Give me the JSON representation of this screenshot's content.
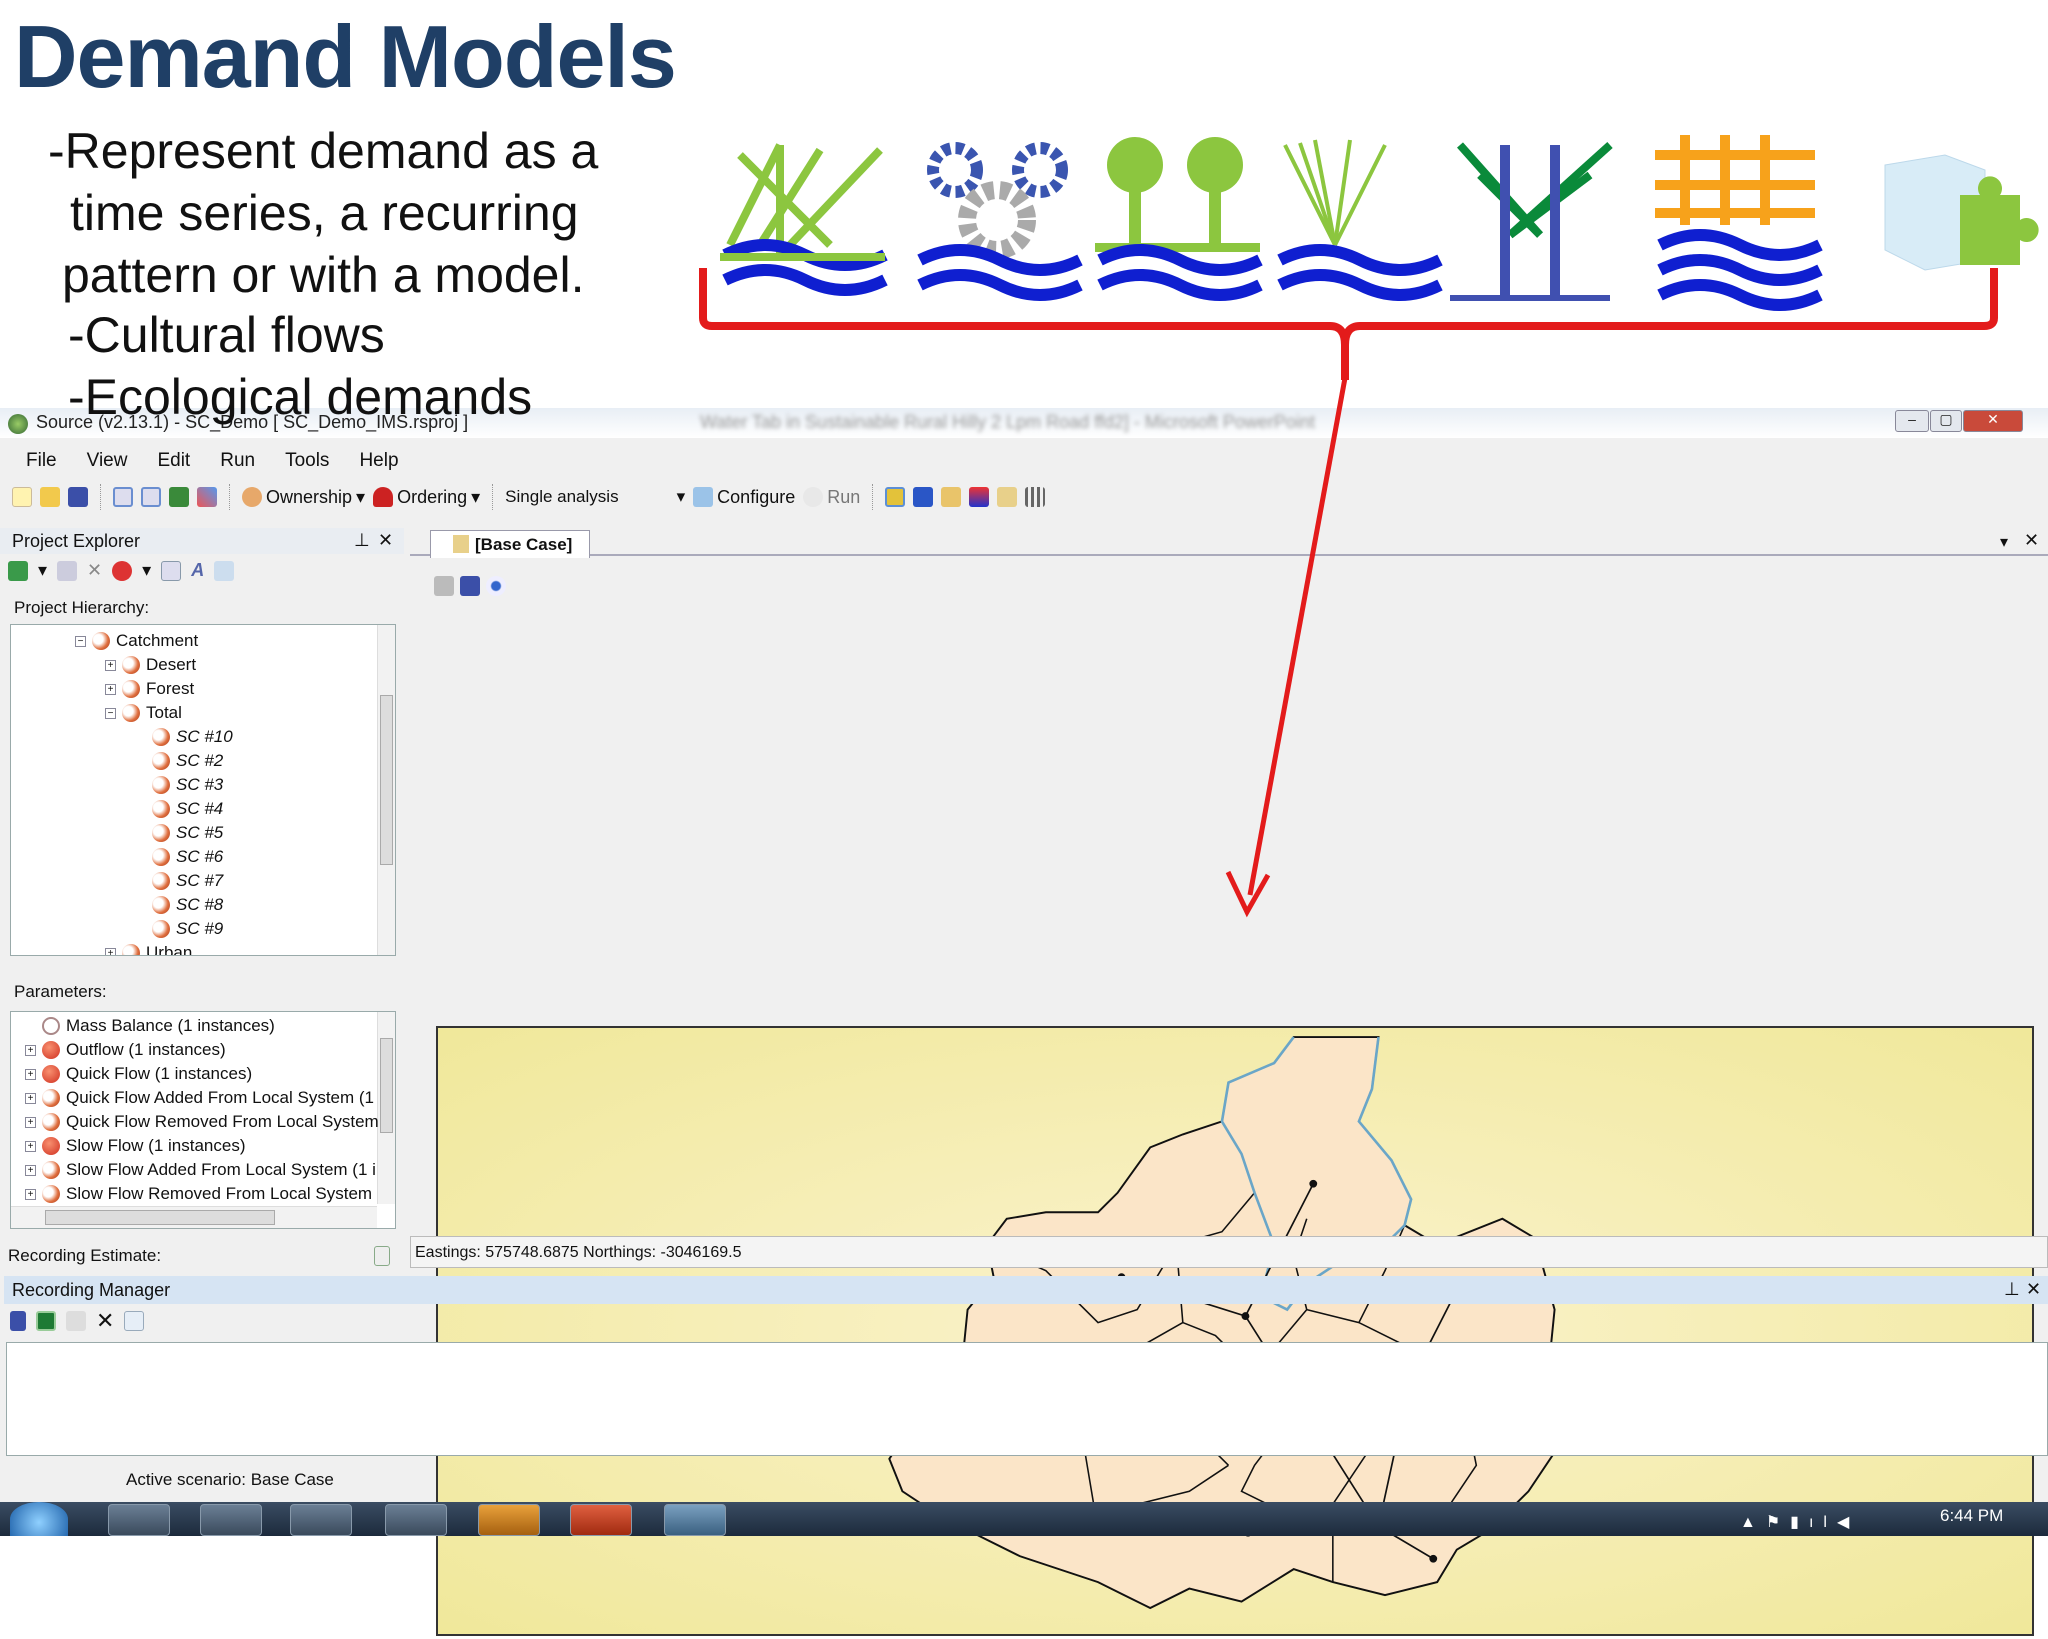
{
  "slide": {
    "title": "Demand Models",
    "bullets": [
      "-Represent demand as a",
      "time series, a recurring",
      "pattern or with a model.",
      "-Cultural flows",
      "-Ecological demands"
    ],
    "icons": [
      "wetland-reeds-icon",
      "industry-gears-icon",
      "trees-water-icon",
      "grass-fan-icon",
      "tall-reeds-icon",
      "irrigation-grid-icon",
      "plugin-cube-icon"
    ],
    "bracket_color": "#e31b1b"
  },
  "window": {
    "title": "Source (v2.13.1) - SC_Demo [ SC_Demo_IMS.rsproj ]",
    "blurred_title": "Water Tab in Sustainable Rural Hilly 2 Lpm Road ffd2] - Microsoft PowerPoint",
    "menu": [
      "File",
      "View",
      "Edit",
      "Run",
      "Tools",
      "Help"
    ],
    "toolbar": {
      "ownership": "Ownership",
      "ordering": "Ordering",
      "analysis": "Single analysis",
      "configure": "Configure",
      "run": "Run"
    }
  },
  "project_explorer": {
    "title": "Project Explorer",
    "hierarchy_label": "Project Hierarchy:",
    "tree": [
      {
        "label": "Catchment",
        "level": 0,
        "expander": "-"
      },
      {
        "label": "Desert",
        "level": 1,
        "expander": "+"
      },
      {
        "label": "Forest",
        "level": 1,
        "expander": "+"
      },
      {
        "label": "Total",
        "level": 1,
        "expander": "-"
      },
      {
        "label": "SC #10",
        "level": 2
      },
      {
        "label": "SC #2",
        "level": 2
      },
      {
        "label": "SC #3",
        "level": 2
      },
      {
        "label": "SC #4",
        "level": 2
      },
      {
        "label": "SC #5",
        "level": 2
      },
      {
        "label": "SC #6",
        "level": 2
      },
      {
        "label": "SC #7",
        "level": 2
      },
      {
        "label": "SC #8",
        "level": 2
      },
      {
        "label": "SC #9",
        "level": 2
      },
      {
        "label": "Urban",
        "level": 1,
        "expander": "+"
      }
    ],
    "parameters_label": "Parameters:",
    "parameters": [
      {
        "label": "Mass Balance (1 instances)",
        "style": "empty"
      },
      {
        "label": "Outflow (1 instances)",
        "style": "red"
      },
      {
        "label": "Quick Flow (1 instances)",
        "style": "red"
      },
      {
        "label": "Quick Flow Added From Local System (1",
        "style": "half"
      },
      {
        "label": "Quick Flow Removed From Local System",
        "style": "half"
      },
      {
        "label": "Slow Flow (1 instances)",
        "style": "red"
      },
      {
        "label": "Slow Flow Added From Local System (1 i",
        "style": "half"
      },
      {
        "label": "Slow Flow Removed From Local System",
        "style": "half"
      }
    ],
    "recording_estimate": "Recording Estimate:"
  },
  "document": {
    "tab": "[Base Case]",
    "status": "Eastings: 575748.6875 Northings: -3046169.5"
  },
  "recording_manager": {
    "title": "Recording Manager"
  },
  "status": {
    "active_scenario": "Active scenario: Base Case"
  },
  "taskbar": {
    "clock": "6:44 PM"
  }
}
